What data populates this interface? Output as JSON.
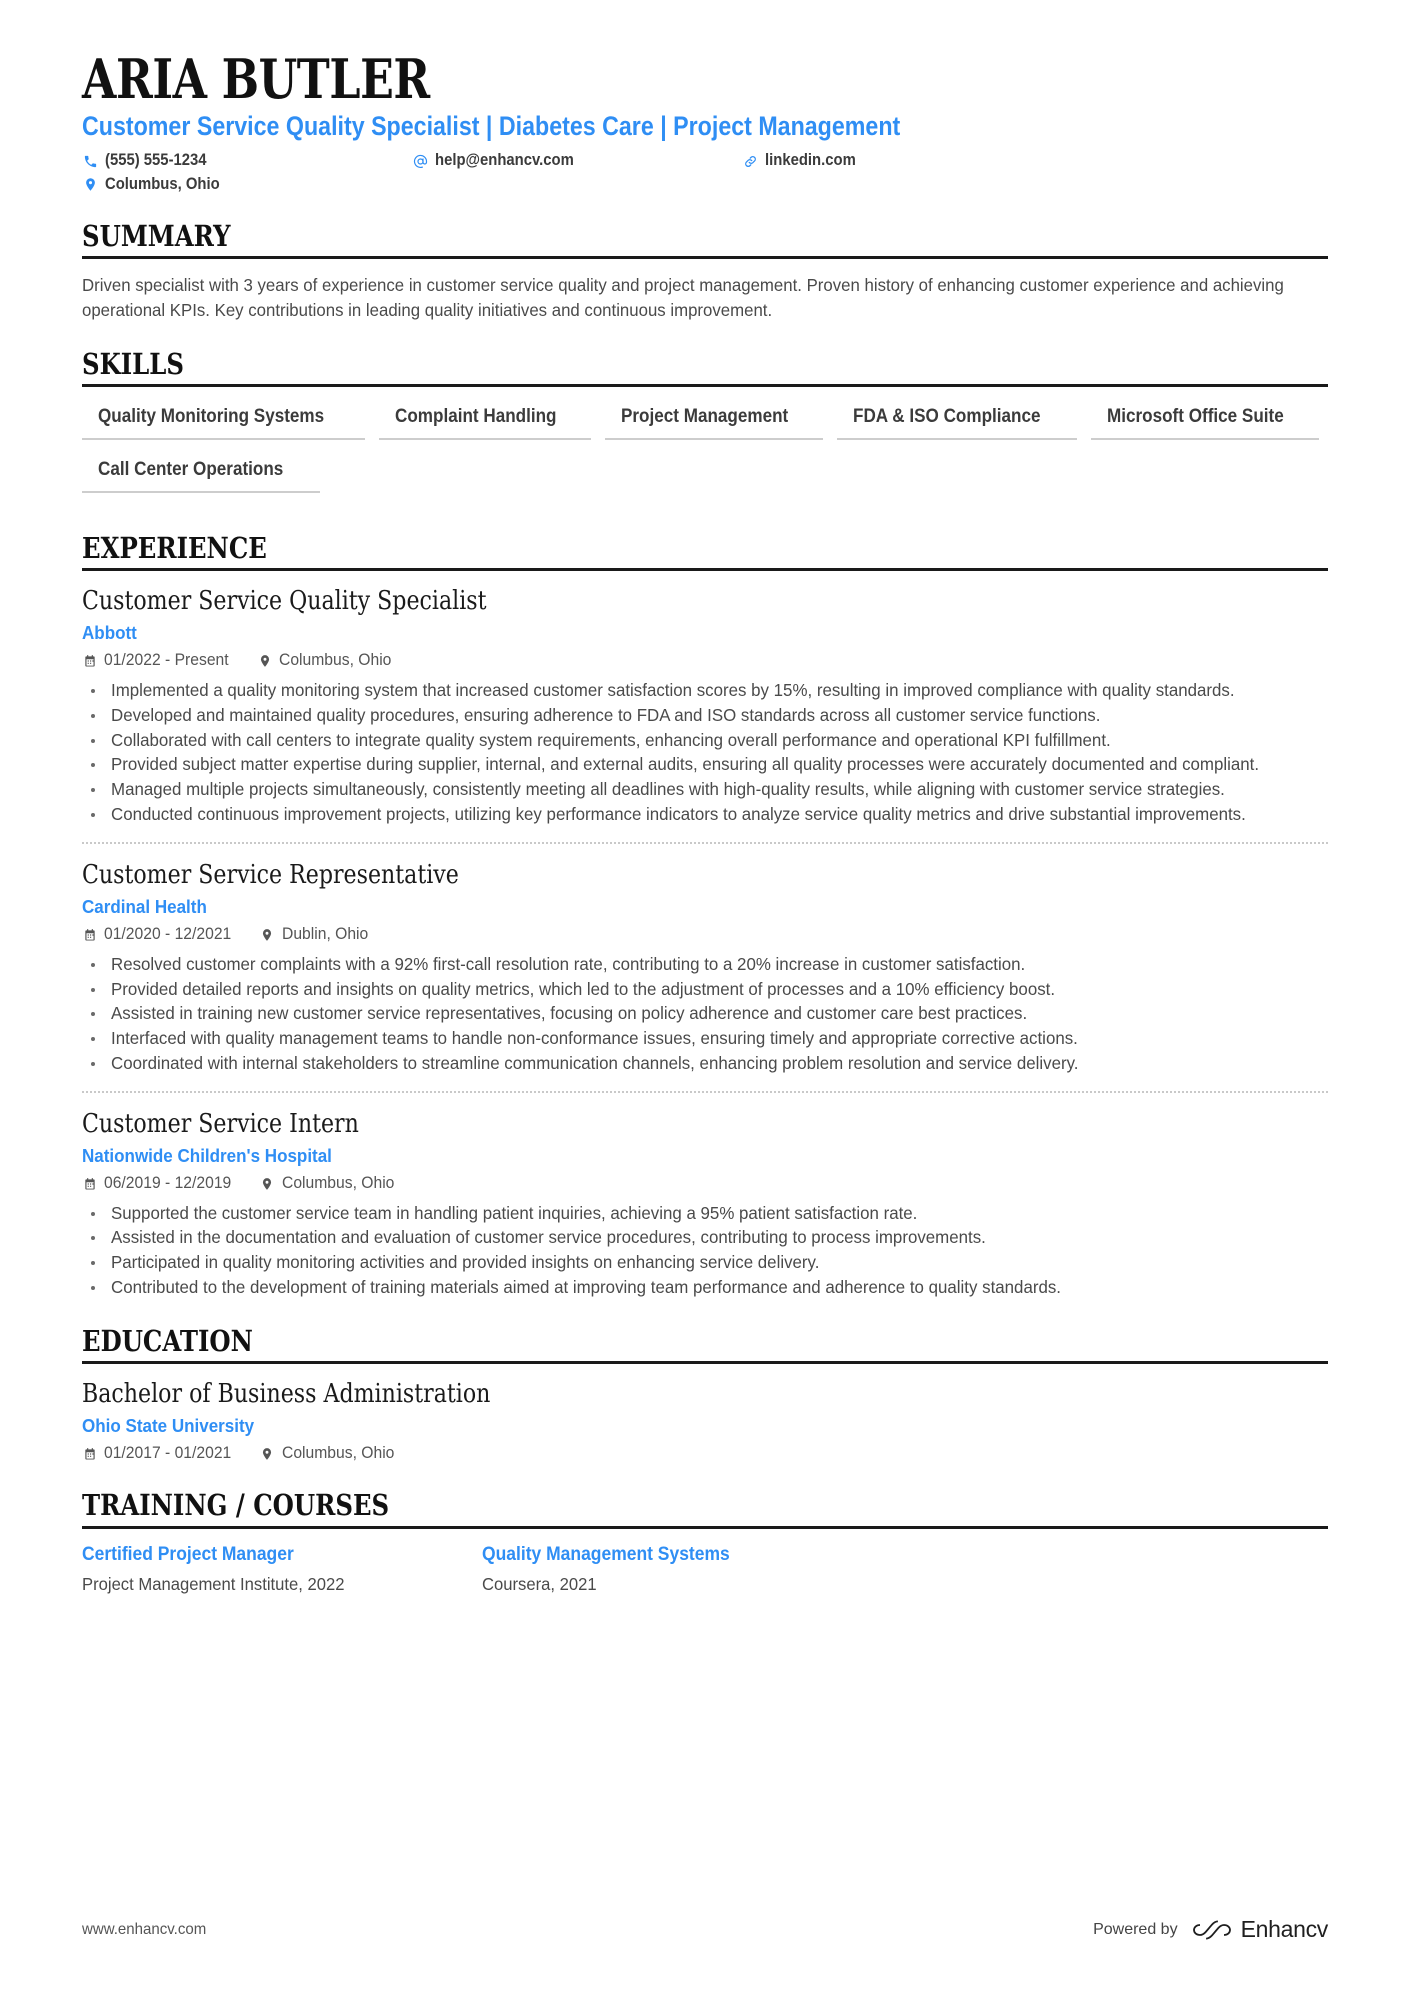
{
  "header": {
    "name": "ARIA BUTLER",
    "headline": "Customer Service Quality Specialist | Diabetes Care | Project Management",
    "contacts": {
      "phone": "(555) 555-1234",
      "email": "help@enhancv.com",
      "link": "linkedin.com",
      "location": "Columbus, Ohio"
    }
  },
  "sections": {
    "summary": {
      "title": "SUMMARY",
      "text": "Driven specialist with 3 years of experience in customer service quality and project management. Proven history of enhancing customer experience and achieving operational KPIs. Key contributions in leading quality initiatives and continuous improvement."
    },
    "skills": {
      "title": "SKILLS",
      "items": [
        "Quality Monitoring Systems",
        "Complaint Handling",
        "Project Management",
        "FDA & ISO Compliance",
        "Microsoft Office Suite",
        "Call Center Operations"
      ]
    },
    "experience": {
      "title": "EXPERIENCE",
      "entries": [
        {
          "role": "Customer Service Quality Specialist",
          "company": "Abbott",
          "dates": "01/2022 - Present",
          "location": "Columbus, Ohio",
          "bullets": [
            "Implemented a quality monitoring system that increased customer satisfaction scores by 15%, resulting in improved compliance with quality standards.",
            "Developed and maintained quality procedures, ensuring adherence to FDA and ISO standards across all customer service functions.",
            "Collaborated with call centers to integrate quality system requirements, enhancing overall performance and operational KPI fulfillment.",
            "Provided subject matter expertise during supplier, internal, and external audits, ensuring all quality processes were accurately documented and compliant.",
            "Managed multiple projects simultaneously, consistently meeting all deadlines with high-quality results, while aligning with customer service strategies.",
            "Conducted continuous improvement projects, utilizing key performance indicators to analyze service quality metrics and drive substantial improvements."
          ]
        },
        {
          "role": "Customer Service Representative",
          "company": "Cardinal Health",
          "dates": "01/2020 - 12/2021",
          "location": "Dublin, Ohio",
          "bullets": [
            "Resolved customer complaints with a 92% first-call resolution rate, contributing to a 20% increase in customer satisfaction.",
            "Provided detailed reports and insights on quality metrics, which led to the adjustment of processes and a 10% efficiency boost.",
            "Assisted in training new customer service representatives, focusing on policy adherence and customer care best practices.",
            "Interfaced with quality management teams to handle non-conformance issues, ensuring timely and appropriate corrective actions.",
            "Coordinated with internal stakeholders to streamline communication channels, enhancing problem resolution and service delivery."
          ]
        },
        {
          "role": "Customer Service Intern",
          "company": "Nationwide Children's Hospital",
          "dates": "06/2019 - 12/2019",
          "location": "Columbus, Ohio",
          "bullets": [
            "Supported the customer service team in handling patient inquiries, achieving a 95% patient satisfaction rate.",
            "Assisted in the documentation and evaluation of customer service procedures, contributing to process improvements.",
            "Participated in quality monitoring activities and provided insights on enhancing service delivery.",
            "Contributed to the development of training materials aimed at improving team performance and adherence to quality standards."
          ]
        }
      ]
    },
    "education": {
      "title": "EDUCATION",
      "entries": [
        {
          "degree": "Bachelor of Business Administration",
          "school": "Ohio State University",
          "dates": "01/2017 - 01/2021",
          "location": "Columbus, Ohio"
        }
      ]
    },
    "training": {
      "title": "TRAINING / COURSES",
      "courses": [
        {
          "name": "Certified Project Manager",
          "provider": "Project Management Institute, 2022"
        },
        {
          "name": "Quality Management Systems",
          "provider": "Coursera, 2021"
        }
      ]
    }
  },
  "footer": {
    "url": "www.enhancv.com",
    "powered_by": "Powered by",
    "brand": "Enhancv"
  }
}
